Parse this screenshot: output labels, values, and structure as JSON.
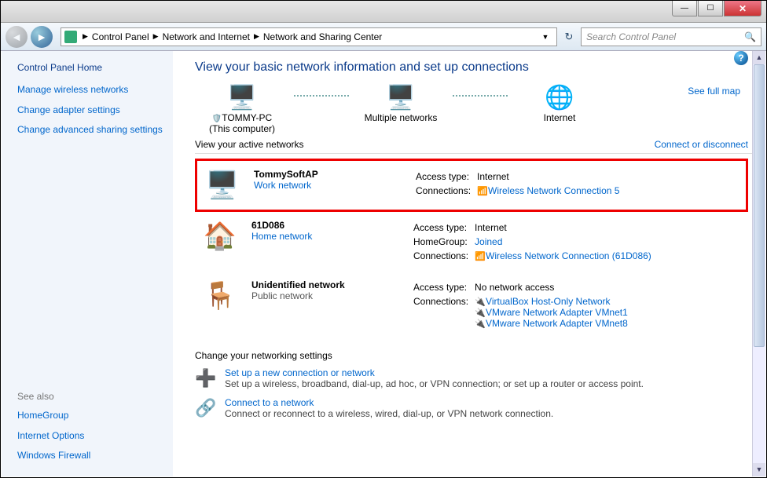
{
  "breadcrumb": {
    "item1": "Control Panel",
    "item2": "Network and Internet",
    "item3": "Network and Sharing Center"
  },
  "search": {
    "placeholder": "Search Control Panel"
  },
  "sidebar": {
    "home": "Control Panel Home",
    "links": [
      "Manage wireless networks",
      "Change adapter settings",
      "Change advanced sharing settings"
    ],
    "seealso": "See also",
    "seealso_links": [
      "HomeGroup",
      "Internet Options",
      "Windows Firewall"
    ]
  },
  "main": {
    "heading": "View your basic network information and set up connections",
    "map": {
      "pc": "TOMMY-PC",
      "pc_sub": "(This computer)",
      "mid": "Multiple networks",
      "inet": "Internet",
      "fullmap": "See full map"
    },
    "active_label": "View your active networks",
    "active_right": "Connect or disconnect",
    "labels": {
      "access_type": "Access type:",
      "connections": "Connections:",
      "homegroup": "HomeGroup:"
    },
    "net1": {
      "name": "TommySoftAP",
      "type": "Work network",
      "access": "Internet",
      "conn": "Wireless Network Connection 5"
    },
    "net2": {
      "name": "61D086",
      "type": "Home network",
      "access": "Internet",
      "homegroup": "Joined",
      "conn": "Wireless Network Connection (61D086)"
    },
    "net3": {
      "name": "Unidentified network",
      "type": "Public network",
      "access": "No network access",
      "conns": [
        "VirtualBox Host-Only Network",
        "VMware Network Adapter VMnet1",
        "VMware Network Adapter VMnet8"
      ]
    },
    "settings": {
      "head": "Change your networking settings",
      "s1": {
        "title": "Set up a new connection or network",
        "desc": "Set up a wireless, broadband, dial-up, ad hoc, or VPN connection; or set up a router or access point."
      },
      "s2": {
        "title": "Connect to a network",
        "desc": "Connect or reconnect to a wireless, wired, dial-up, or VPN network connection."
      }
    }
  }
}
